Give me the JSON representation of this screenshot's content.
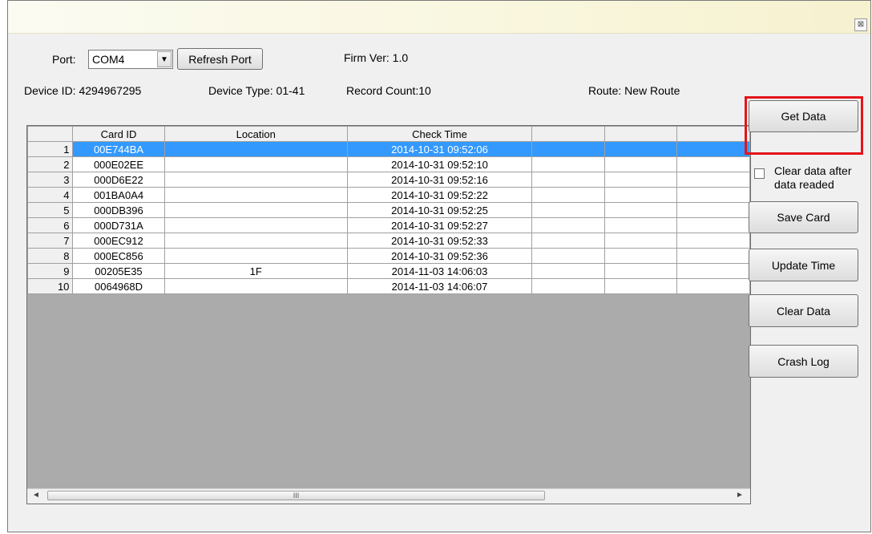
{
  "window": {
    "close_glyph": "⊠"
  },
  "port": {
    "label": "Port:",
    "selected": "COM4",
    "refresh_label": "Refresh Port"
  },
  "firmware": "Firm Ver: 1.0",
  "device": {
    "id_text": "Device ID: 4294967295",
    "type_text": "Device Type: 01-41",
    "record_count_text": "Record Count:10",
    "route_text": "Route: New Route"
  },
  "grid": {
    "columns": [
      "",
      "Card ID",
      "Location",
      "Check Time",
      "",
      "",
      ""
    ],
    "rows": [
      {
        "num": "1",
        "card_id": "00E744BA",
        "location": "",
        "check_time": "2014-10-31 09:52:06"
      },
      {
        "num": "2",
        "card_id": "000E02EE",
        "location": "",
        "check_time": "2014-10-31 09:52:10"
      },
      {
        "num": "3",
        "card_id": "000D6E22",
        "location": "",
        "check_time": "2014-10-31 09:52:16"
      },
      {
        "num": "4",
        "card_id": "001BA0A4",
        "location": "",
        "check_time": "2014-10-31 09:52:22"
      },
      {
        "num": "5",
        "card_id": "000DB396",
        "location": "",
        "check_time": "2014-10-31 09:52:25"
      },
      {
        "num": "6",
        "card_id": "000D731A",
        "location": "",
        "check_time": "2014-10-31 09:52:27"
      },
      {
        "num": "7",
        "card_id": "000EC912",
        "location": "",
        "check_time": "2014-10-31 09:52:33"
      },
      {
        "num": "8",
        "card_id": "000EC856",
        "location": "",
        "check_time": "2014-10-31 09:52:36"
      },
      {
        "num": "9",
        "card_id": "00205E35",
        "location": "1F",
        "check_time": "2014-11-03 14:06:03"
      },
      {
        "num": "10",
        "card_id": "0064968D",
        "location": "",
        "check_time": "2014-11-03 14:06:07"
      }
    ],
    "selected_row": "1",
    "scroll_left": "◄",
    "scroll_right": "►",
    "scroll_grip": "III"
  },
  "actions": {
    "get_data": "Get Data",
    "clear_after_label": "Clear data after data readed",
    "clear_after_checked": false,
    "save_card": "Save Card",
    "update_time": "Update Time",
    "clear_data": "Clear Data",
    "crash_log": "Crash Log"
  },
  "colors": {
    "selection": "#3399ff",
    "highlight_frame": "#e4141a",
    "grid_empty": "#ababab"
  }
}
